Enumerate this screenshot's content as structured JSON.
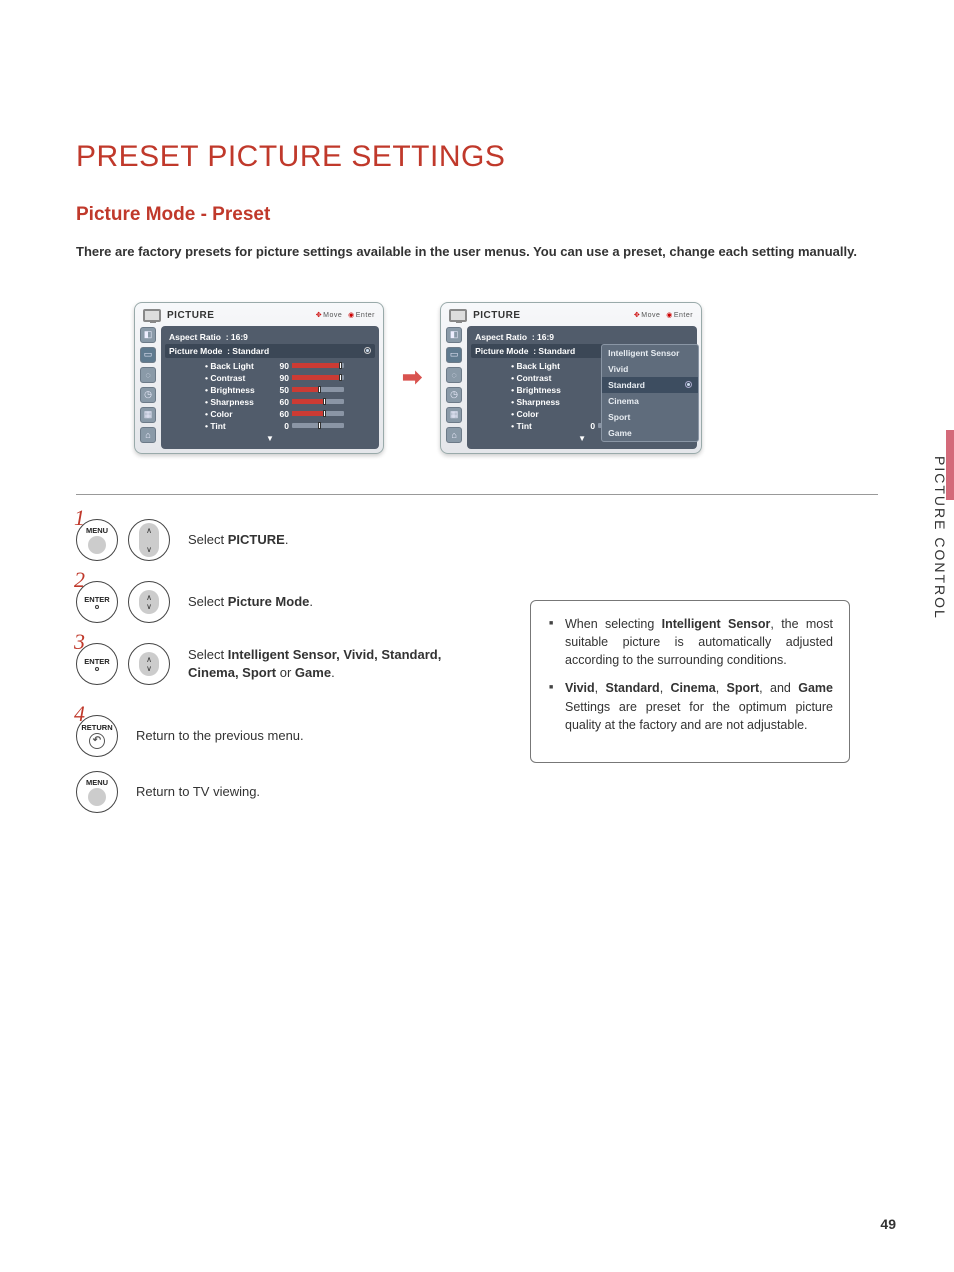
{
  "page": {
    "title": "PRESET PICTURE SETTINGS",
    "subtitle": "Picture Mode - Preset",
    "intro": "There are factory presets for picture settings available in the user menus. You can use a preset, change each setting manually.",
    "side_tab": "PICTURE CONTROL",
    "number": "49"
  },
  "osd": {
    "header": "PICTURE",
    "hint_move": "Move",
    "hint_enter": "Enter",
    "aspect_label": "Aspect Ratio",
    "aspect_value": ": 16:9",
    "mode_label": "Picture Mode",
    "mode_value": ": Standard",
    "params": [
      {
        "label": "• Back Light",
        "value": "90",
        "fill": 90
      },
      {
        "label": "• Contrast",
        "value": "90",
        "fill": 90
      },
      {
        "label": "• Brightness",
        "value": "50",
        "fill": 50
      },
      {
        "label": "• Sharpness",
        "value": "60",
        "fill": 60
      },
      {
        "label": "• Color",
        "value": "60",
        "fill": 60
      }
    ],
    "tint": {
      "label": "• Tint",
      "value": "0"
    },
    "popup_items": [
      "Intelligent Sensor",
      "Vivid",
      "Standard",
      "Cinema",
      "Sport",
      "Game"
    ],
    "popup_selected": "Standard"
  },
  "steps": {
    "s1": {
      "btn": "MENU",
      "text_a": "Select ",
      "text_b": "PICTURE",
      "text_c": "."
    },
    "s2": {
      "btn": "ENTER",
      "text_a": "Select ",
      "text_b": "Picture Mode",
      "text_c": "."
    },
    "s3": {
      "btn": "ENTER",
      "text_a": "Select ",
      "opts": "Intelligent Sensor, Vivid, Standard, Cinema, Sport",
      "or": " or ",
      "last": "Game",
      "text_c": "."
    },
    "s4": {
      "btn": "RETURN",
      "text": "Return to the previous menu."
    },
    "s5": {
      "btn": "MENU",
      "text": "Return to TV viewing."
    }
  },
  "info": {
    "b1a": "When selecting ",
    "b1b": "Intelligent Sensor",
    "b1c": ", the most suitable picture is automatically adjusted according to the surrounding conditions.",
    "b2a": "Vivid",
    "b2b": ", ",
    "b2c": "Standard",
    "b2d": ", ",
    "b2e": "Cinema",
    "b2f": ", ",
    "b2g": "Sport",
    "b2h": ", and ",
    "b2i": "Game",
    "b2j": " Settings are preset for the optimum picture quality at the factory and are not adjustable."
  }
}
